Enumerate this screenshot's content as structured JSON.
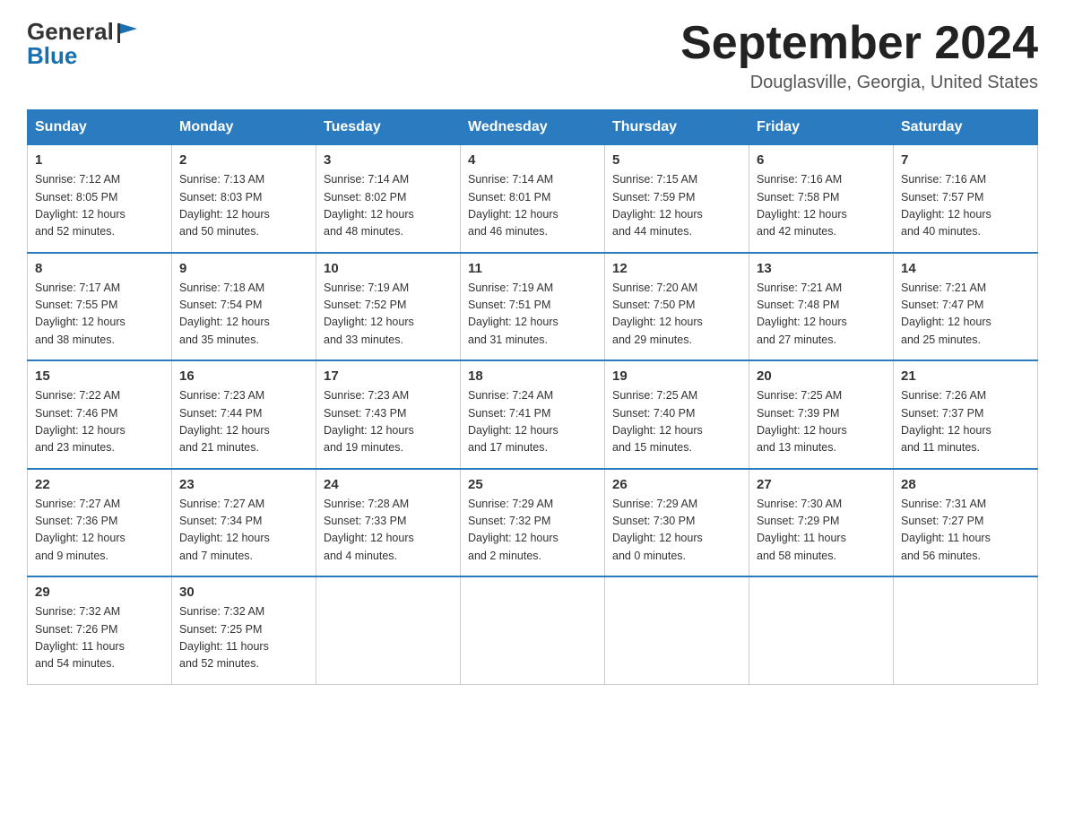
{
  "header": {
    "logo_general": "General",
    "logo_blue": "Blue",
    "month_title": "September 2024",
    "location": "Douglasville, Georgia, United States"
  },
  "days_of_week": [
    "Sunday",
    "Monday",
    "Tuesday",
    "Wednesday",
    "Thursday",
    "Friday",
    "Saturday"
  ],
  "weeks": [
    [
      {
        "day": "1",
        "sunrise": "7:12 AM",
        "sunset": "8:05 PM",
        "daylight": "12 hours and 52 minutes."
      },
      {
        "day": "2",
        "sunrise": "7:13 AM",
        "sunset": "8:03 PM",
        "daylight": "12 hours and 50 minutes."
      },
      {
        "day": "3",
        "sunrise": "7:14 AM",
        "sunset": "8:02 PM",
        "daylight": "12 hours and 48 minutes."
      },
      {
        "day": "4",
        "sunrise": "7:14 AM",
        "sunset": "8:01 PM",
        "daylight": "12 hours and 46 minutes."
      },
      {
        "day": "5",
        "sunrise": "7:15 AM",
        "sunset": "7:59 PM",
        "daylight": "12 hours and 44 minutes."
      },
      {
        "day": "6",
        "sunrise": "7:16 AM",
        "sunset": "7:58 PM",
        "daylight": "12 hours and 42 minutes."
      },
      {
        "day": "7",
        "sunrise": "7:16 AM",
        "sunset": "7:57 PM",
        "daylight": "12 hours and 40 minutes."
      }
    ],
    [
      {
        "day": "8",
        "sunrise": "7:17 AM",
        "sunset": "7:55 PM",
        "daylight": "12 hours and 38 minutes."
      },
      {
        "day": "9",
        "sunrise": "7:18 AM",
        "sunset": "7:54 PM",
        "daylight": "12 hours and 35 minutes."
      },
      {
        "day": "10",
        "sunrise": "7:19 AM",
        "sunset": "7:52 PM",
        "daylight": "12 hours and 33 minutes."
      },
      {
        "day": "11",
        "sunrise": "7:19 AM",
        "sunset": "7:51 PM",
        "daylight": "12 hours and 31 minutes."
      },
      {
        "day": "12",
        "sunrise": "7:20 AM",
        "sunset": "7:50 PM",
        "daylight": "12 hours and 29 minutes."
      },
      {
        "day": "13",
        "sunrise": "7:21 AM",
        "sunset": "7:48 PM",
        "daylight": "12 hours and 27 minutes."
      },
      {
        "day": "14",
        "sunrise": "7:21 AM",
        "sunset": "7:47 PM",
        "daylight": "12 hours and 25 minutes."
      }
    ],
    [
      {
        "day": "15",
        "sunrise": "7:22 AM",
        "sunset": "7:46 PM",
        "daylight": "12 hours and 23 minutes."
      },
      {
        "day": "16",
        "sunrise": "7:23 AM",
        "sunset": "7:44 PM",
        "daylight": "12 hours and 21 minutes."
      },
      {
        "day": "17",
        "sunrise": "7:23 AM",
        "sunset": "7:43 PM",
        "daylight": "12 hours and 19 minutes."
      },
      {
        "day": "18",
        "sunrise": "7:24 AM",
        "sunset": "7:41 PM",
        "daylight": "12 hours and 17 minutes."
      },
      {
        "day": "19",
        "sunrise": "7:25 AM",
        "sunset": "7:40 PM",
        "daylight": "12 hours and 15 minutes."
      },
      {
        "day": "20",
        "sunrise": "7:25 AM",
        "sunset": "7:39 PM",
        "daylight": "12 hours and 13 minutes."
      },
      {
        "day": "21",
        "sunrise": "7:26 AM",
        "sunset": "7:37 PM",
        "daylight": "12 hours and 11 minutes."
      }
    ],
    [
      {
        "day": "22",
        "sunrise": "7:27 AM",
        "sunset": "7:36 PM",
        "daylight": "12 hours and 9 minutes."
      },
      {
        "day": "23",
        "sunrise": "7:27 AM",
        "sunset": "7:34 PM",
        "daylight": "12 hours and 7 minutes."
      },
      {
        "day": "24",
        "sunrise": "7:28 AM",
        "sunset": "7:33 PM",
        "daylight": "12 hours and 4 minutes."
      },
      {
        "day": "25",
        "sunrise": "7:29 AM",
        "sunset": "7:32 PM",
        "daylight": "12 hours and 2 minutes."
      },
      {
        "day": "26",
        "sunrise": "7:29 AM",
        "sunset": "7:30 PM",
        "daylight": "12 hours and 0 minutes."
      },
      {
        "day": "27",
        "sunrise": "7:30 AM",
        "sunset": "7:29 PM",
        "daylight": "11 hours and 58 minutes."
      },
      {
        "day": "28",
        "sunrise": "7:31 AM",
        "sunset": "7:27 PM",
        "daylight": "11 hours and 56 minutes."
      }
    ],
    [
      {
        "day": "29",
        "sunrise": "7:32 AM",
        "sunset": "7:26 PM",
        "daylight": "11 hours and 54 minutes."
      },
      {
        "day": "30",
        "sunrise": "7:32 AM",
        "sunset": "7:25 PM",
        "daylight": "11 hours and 52 minutes."
      },
      null,
      null,
      null,
      null,
      null
    ]
  ],
  "labels": {
    "sunrise": "Sunrise:",
    "sunset": "Sunset:",
    "daylight": "Daylight:"
  }
}
